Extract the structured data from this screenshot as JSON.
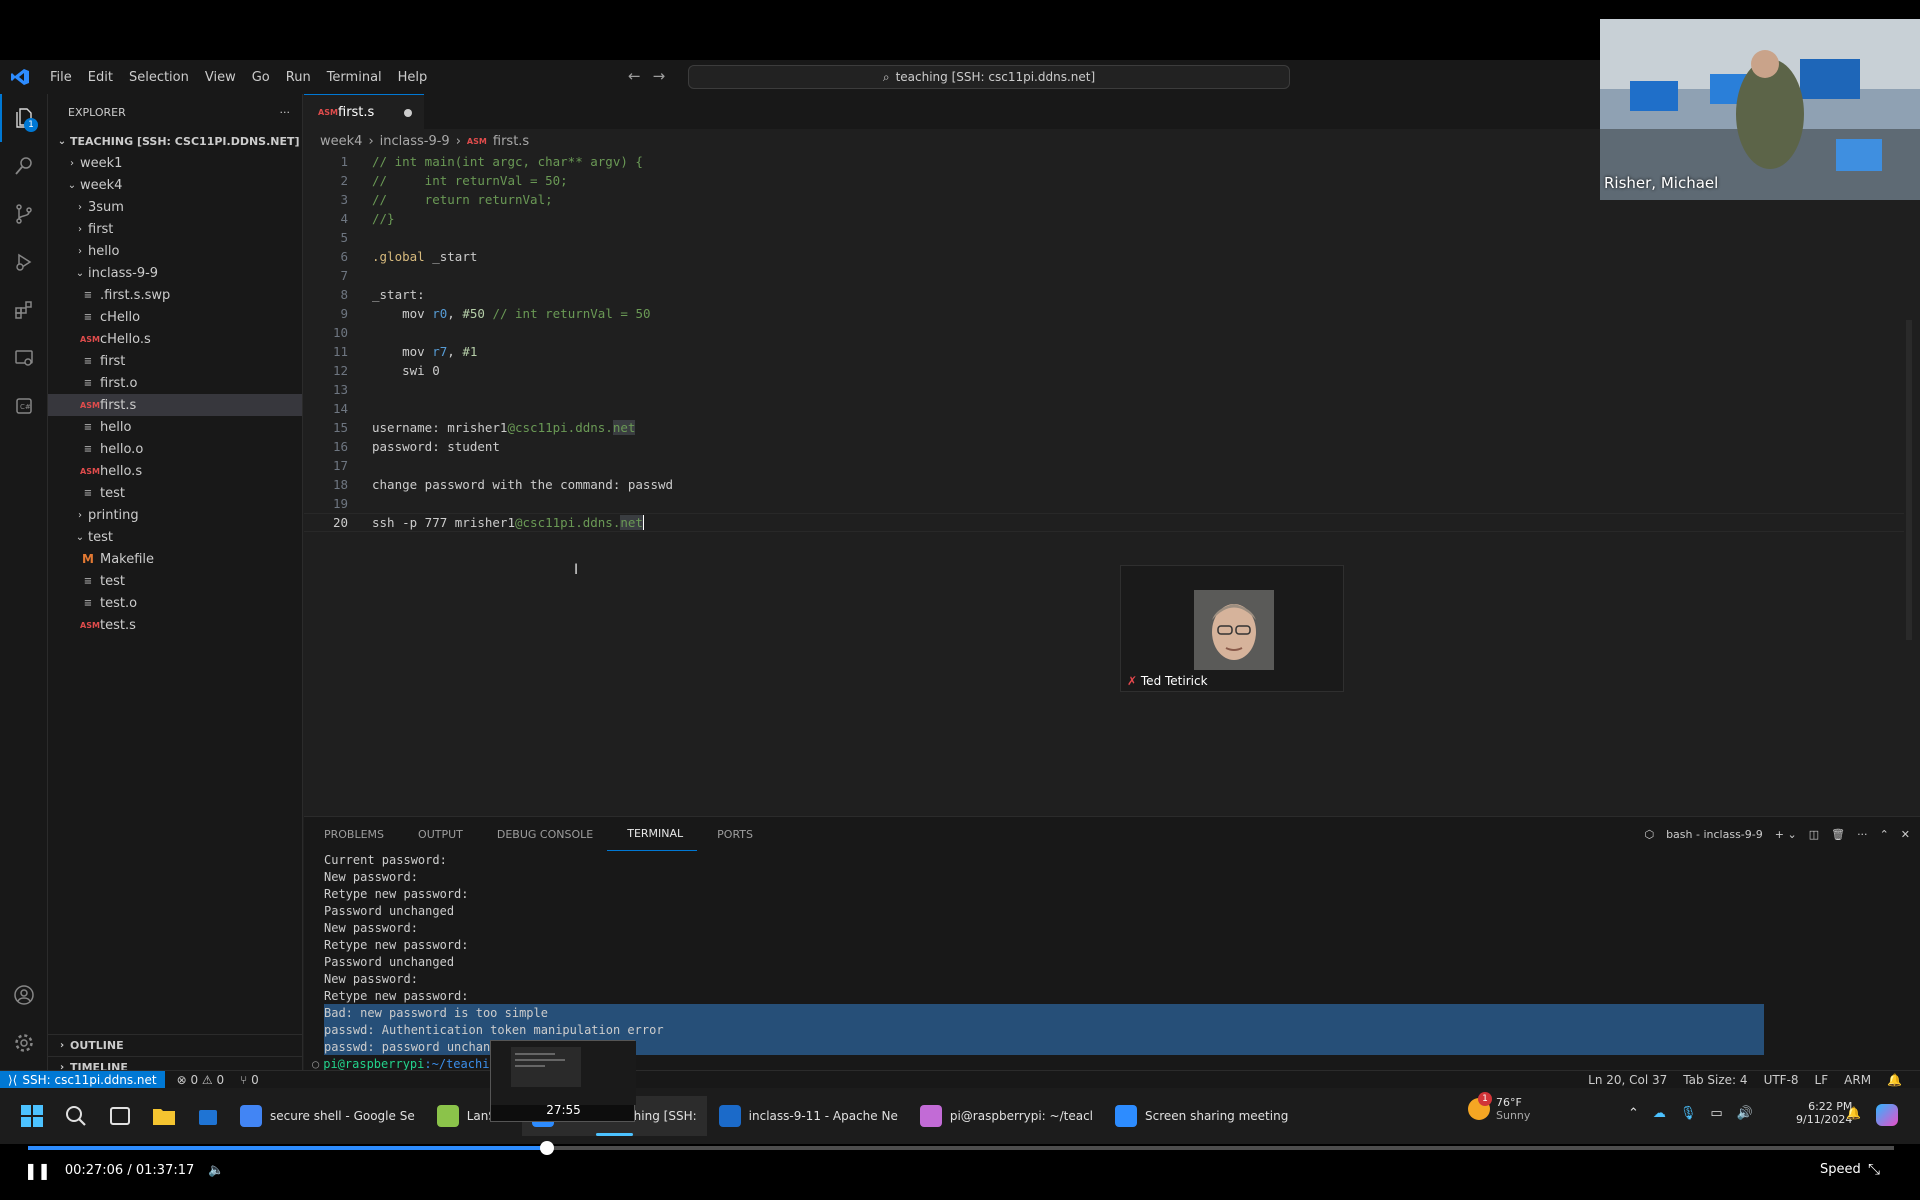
{
  "window": {
    "menus": [
      "File",
      "Edit",
      "Selection",
      "View",
      "Go",
      "Run",
      "Terminal",
      "Help"
    ],
    "command_center": "teaching [SSH: csc11pi.ddns.net]"
  },
  "activity": {
    "badge": "1"
  },
  "explorer": {
    "title": "EXPLORER",
    "more": "···",
    "root": "TEACHING [SSH: CSC11PI.DDNS.NET]",
    "items": [
      {
        "label": "week1",
        "depth": 0,
        "kind": "folder",
        "open": false
      },
      {
        "label": "week4",
        "depth": 0,
        "kind": "folder",
        "open": true
      },
      {
        "label": "3sum",
        "depth": 1,
        "kind": "folder",
        "open": false
      },
      {
        "label": "first",
        "depth": 1,
        "kind": "folder",
        "open": false
      },
      {
        "label": "hello",
        "depth": 1,
        "kind": "folder",
        "open": false
      },
      {
        "label": "inclass-9-9",
        "depth": 1,
        "kind": "folder",
        "open": true
      },
      {
        "label": ".first.s.swp",
        "depth": 2,
        "kind": "lines"
      },
      {
        "label": "cHello",
        "depth": 2,
        "kind": "lines"
      },
      {
        "label": "cHello.s",
        "depth": 2,
        "kind": "asm"
      },
      {
        "label": "first",
        "depth": 2,
        "kind": "lines"
      },
      {
        "label": "first.o",
        "depth": 2,
        "kind": "lines"
      },
      {
        "label": "first.s",
        "depth": 2,
        "kind": "asm",
        "selected": true
      },
      {
        "label": "hello",
        "depth": 2,
        "kind": "lines"
      },
      {
        "label": "hello.o",
        "depth": 2,
        "kind": "lines"
      },
      {
        "label": "hello.s",
        "depth": 2,
        "kind": "asm"
      },
      {
        "label": "test",
        "depth": 2,
        "kind": "lines"
      },
      {
        "label": "printing",
        "depth": 1,
        "kind": "folder",
        "open": false
      },
      {
        "label": "test",
        "depth": 1,
        "kind": "folder",
        "open": true
      },
      {
        "label": "Makefile",
        "depth": 2,
        "kind": "m"
      },
      {
        "label": "test",
        "depth": 2,
        "kind": "lines"
      },
      {
        "label": "test.o",
        "depth": 2,
        "kind": "lines"
      },
      {
        "label": "test.s",
        "depth": 2,
        "kind": "asm"
      }
    ],
    "outline": "OUTLINE",
    "timeline": "TIMELINE",
    "asm_icon_text": "ASM",
    "m_icon_text": "M"
  },
  "editor": {
    "tab": "first.s",
    "breadcrumb": [
      "week4",
      "inclass-9-9",
      "first.s"
    ],
    "current_line": 20
  },
  "code": [
    "// int main(int argc, char** argv) {",
    "//     int returnVal = 50;",
    "//     return returnVal;",
    "//}",
    "",
    ".global _start",
    "",
    "_start:",
    "    mov r0, #50 // int returnVal = 50",
    "",
    "    mov r7, #1",
    "    swi 0",
    "",
    "",
    "username: mrisher1@csc11pi.ddns.net",
    "password: student",
    "",
    "change password with the command: passwd",
    "",
    "ssh -p 777 mrisher1@csc11pi.ddns.net"
  ],
  "panel": {
    "tabs": [
      "PROBLEMS",
      "OUTPUT",
      "DEBUG CONSOLE",
      "TERMINAL",
      "PORTS"
    ],
    "active_tab": "TERMINAL",
    "shell": "bash - inclass-9-9",
    "terminal_lines": [
      "Current password:",
      "New password:",
      "Retype new password:",
      "Password unchanged",
      "New password:",
      "Retype new password:",
      "Password unchanged",
      "New password:",
      "Retype new password:",
      "Bad: new password is too simple",
      "passwd: Authentication token manipulation error",
      "passwd: password unchang"
    ],
    "selected_from": 9,
    "prompt_user": "pi@raspberrypi",
    "prompt_path": ":~/teachin"
  },
  "status": {
    "remote": "SSH: csc11pi.ddns.net",
    "problems": "⊗ 0 ⚠ 0",
    "ports": "⑂ 0",
    "position": "Ln 20, Col 37",
    "tab_size": "Tab Size: 4",
    "encoding": "UTF-8",
    "eol": "LF",
    "language": "ARM"
  },
  "taskbar": {
    "apps": [
      {
        "label": "secure shell - Google Se",
        "color": "#4285f4"
      },
      {
        "label": "LanSch",
        "color": "#8bc34a"
      },
      {
        "label": "first.s - teaching [SSH:",
        "color": "#2d8cff",
        "active": true
      },
      {
        "label": "inclass-9-11 - Apache Ne",
        "color": "#1b6ac9"
      },
      {
        "label": "pi@raspberrypi: ~/teacl",
        "color": "#c26bd6"
      },
      {
        "label": "Screen sharing meeting",
        "color": "#2d8cff"
      }
    ],
    "weather_temp": "76°F",
    "weather_desc": "Sunny",
    "weather_badge": "1",
    "time": "6:22 PM",
    "date": "9/11/2024"
  },
  "video": {
    "elapsed": "00:27:06",
    "total": "01:37:17",
    "progress": 0.2782,
    "speed_label": "Speed",
    "thumb_time": "27:55"
  },
  "participants": {
    "camera_name": "Risher, Michael",
    "tile_name": "Ted Tetirick"
  },
  "colors": {
    "accent": "#0078d4",
    "zoom_blue": "#2d8cff"
  }
}
